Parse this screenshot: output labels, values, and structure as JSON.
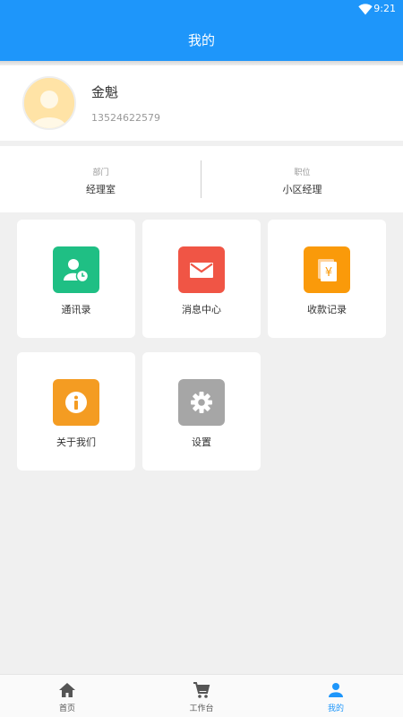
{
  "status_bar": {
    "time": "9:21",
    "wifi_icon": "wifi-icon"
  },
  "header": {
    "title": "我的"
  },
  "profile": {
    "name": "金魁",
    "phone": "13524622579",
    "avatar_icon": "avatar-placeholder-icon"
  },
  "info": {
    "department": {
      "label": "部门",
      "value": "经理室"
    },
    "position": {
      "label": "职位",
      "value": "小区经理"
    }
  },
  "menu": [
    {
      "label": "通讯录",
      "icon": "contacts-icon",
      "color": "#1fbf84"
    },
    {
      "label": "消息中心",
      "icon": "mail-icon",
      "color": "#f05545"
    },
    {
      "label": "收款记录",
      "icon": "yen-receipt-icon",
      "color": "#fa9a0a"
    },
    {
      "label": "关于我们",
      "icon": "info-icon",
      "color": "#f49c22"
    },
    {
      "label": "设置",
      "icon": "gear-icon",
      "color": "#a6a6a6"
    }
  ],
  "tabs": [
    {
      "label": "首页",
      "icon": "home-icon"
    },
    {
      "label": "工作台",
      "icon": "cart-icon"
    },
    {
      "label": "我的",
      "icon": "person-icon",
      "active": true
    }
  ],
  "colors": {
    "primary": "#1e96fa"
  }
}
